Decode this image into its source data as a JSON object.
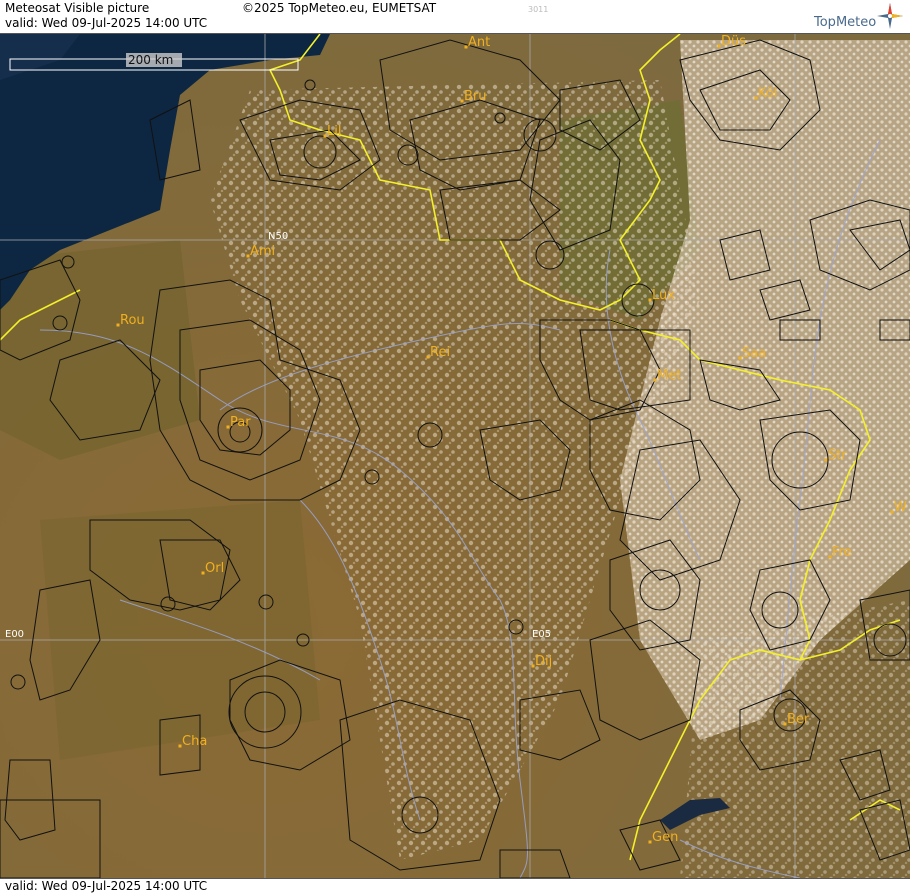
{
  "header": {
    "title": "Meteosat Visible picture",
    "valid": "valid:  Wed  09-Jul-2025  14:00 UTC",
    "copyright": "©2025 TopMeteo.eu, EUMETSAT",
    "code": "3011",
    "logo_text": "TopMeteo"
  },
  "footer": {
    "valid": "valid:  Wed  09-Jul-2025  14:00 UTC"
  },
  "map": {
    "scale_label": "200 km",
    "grid_labels": {
      "lat_n50": "N50",
      "lon_e00": "E00",
      "lon_e05": "E05"
    },
    "cities": [
      {
        "label": "Ant"
      },
      {
        "label": "Düs"
      },
      {
        "label": "Bru"
      },
      {
        "label": "Köl"
      },
      {
        "label": "Lil"
      },
      {
        "label": "Ami"
      },
      {
        "label": "Rou"
      },
      {
        "label": "Lux"
      },
      {
        "label": "Rei"
      },
      {
        "label": "Saa"
      },
      {
        "label": "Met"
      },
      {
        "label": "Par"
      },
      {
        "label": "Str"
      },
      {
        "label": "W"
      },
      {
        "label": "Fre"
      },
      {
        "label": "Orl"
      },
      {
        "label": "Dij"
      },
      {
        "label": "Ber"
      },
      {
        "label": "Cha"
      },
      {
        "label": "Gen"
      }
    ],
    "colors": {
      "sea": "#0d2742",
      "land": "#8a6e3c",
      "cloud": "#e8d8c4",
      "border": "#f4f02a",
      "river": "#9aa6d8",
      "airspace": "#111111",
      "grid": "#a8a8a8",
      "city": "#f0b020"
    }
  }
}
